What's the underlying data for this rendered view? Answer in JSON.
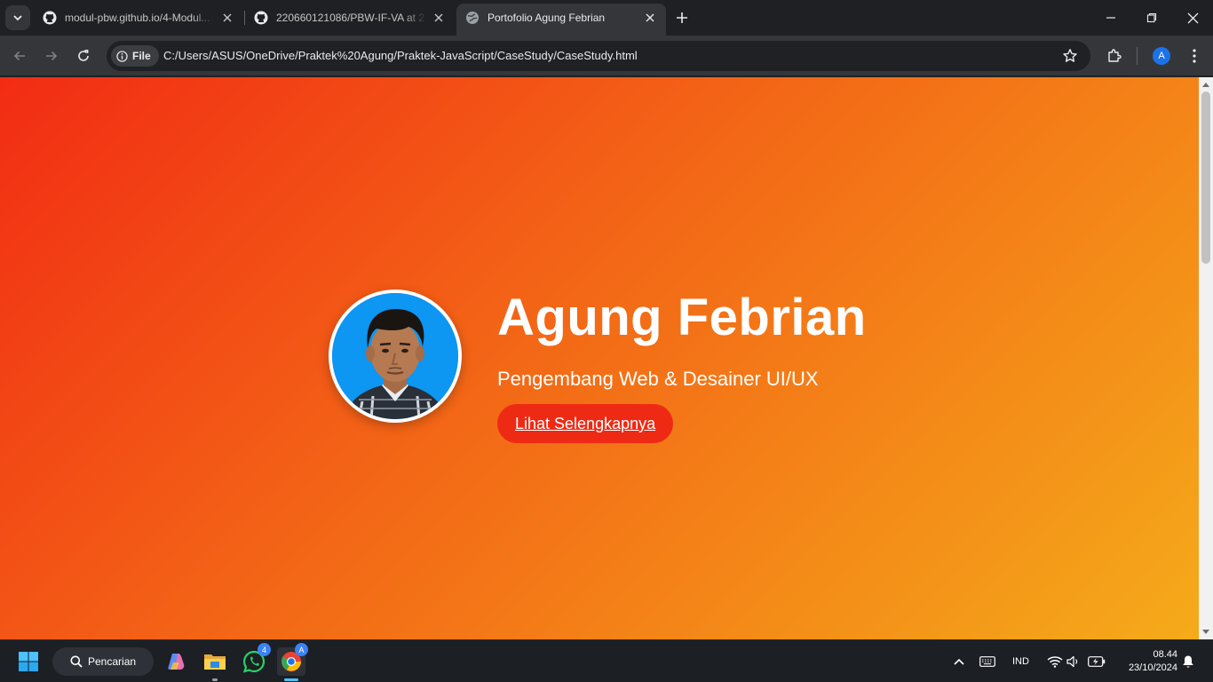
{
  "browser": {
    "tabs": [
      {
        "title": "modul-pbw.github.io/4-Modul...",
        "favicon": "github-icon",
        "active": false
      },
      {
        "title": "220660121086/PBW-IF-VA at 22",
        "favicon": "github-icon",
        "active": false
      },
      {
        "title": "Portofolio Agung Febrian",
        "favicon": "globe-icon",
        "active": true
      }
    ],
    "address": {
      "chip_label": "File",
      "url": "C:/Users/ASUS/OneDrive/Praktek%20Agung/Praktek-JavaScript/CaseStudy/CaseStudy.html"
    },
    "profile_initial": "A"
  },
  "page": {
    "name": "Agung Febrian",
    "role": "Pengembang Web & Desainer UI/UX",
    "cta_label": "Lihat Selengkapnya",
    "colors": {
      "gradient_start": "#f22c14",
      "gradient_mid": "#f36716",
      "gradient_end": "#f5ab1a",
      "cta_background": "#ee2a14",
      "avatar_background": "#0d96f2"
    }
  },
  "taskbar": {
    "search_label": "Pencarian",
    "whatsapp_badge": "4",
    "chrome_badge": "A",
    "language": "IND",
    "time": "08.44",
    "date": "23/10/2024"
  }
}
